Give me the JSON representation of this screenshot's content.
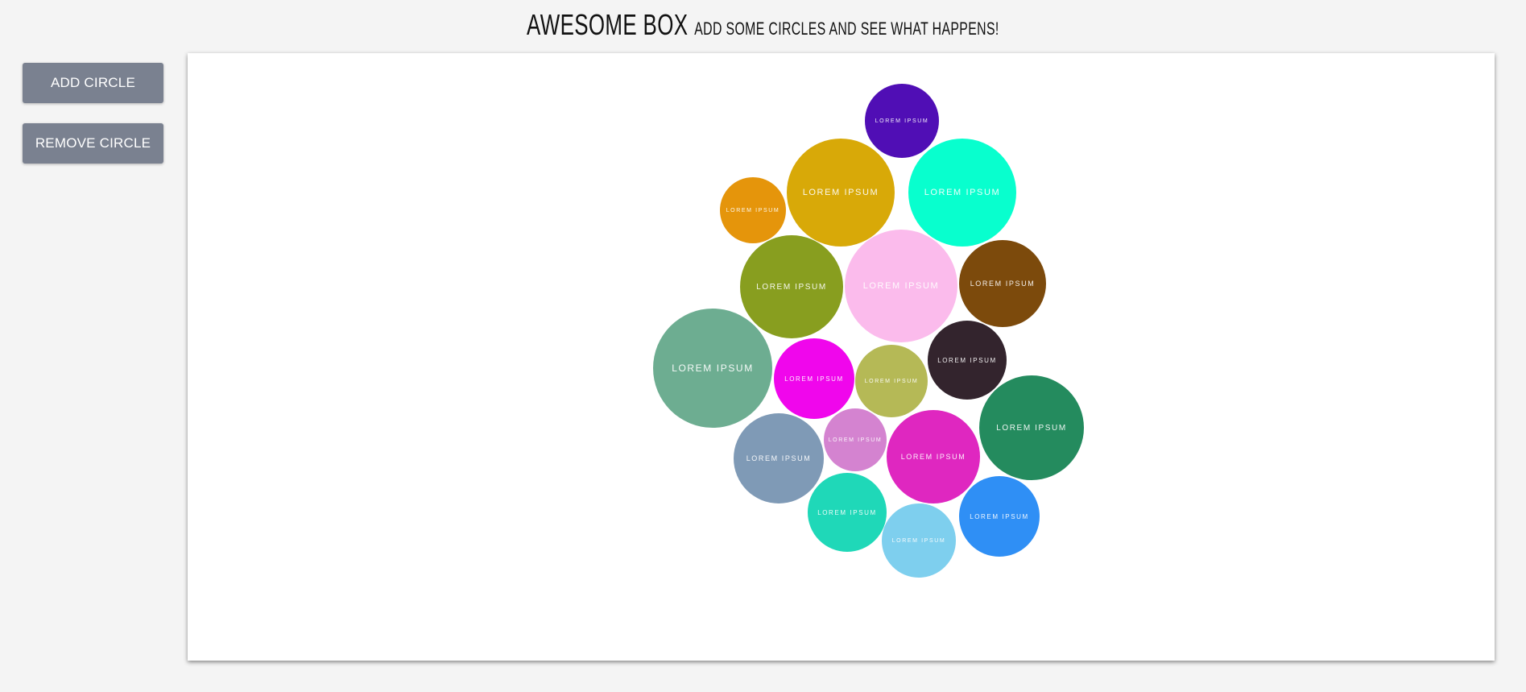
{
  "header": {
    "title": "AWESOME BOX",
    "subtitle": "ADD SOME CIRCLES AND SEE WHAT HAPPENS!"
  },
  "controls": {
    "add_label": "ADD CIRCLE",
    "remove_label": "REMOVE CIRCLE"
  },
  "colors": {
    "page_background": "#f4f4f4",
    "button_background": "#7a8190",
    "button_text": "#ffffff",
    "box_background": "#ffffff"
  },
  "circles": [
    {
      "label": "LOREM IPSUM",
      "color": "#500eb5"
    },
    {
      "label": "LOREM IPSUM",
      "color": "#d8a908"
    },
    {
      "label": "LOREM IPSUM",
      "color": "#08ffce"
    },
    {
      "label": "LOREM IPSUM",
      "color": "#e5950b"
    },
    {
      "label": "LOREM IPSUM",
      "color": "#889e1f"
    },
    {
      "label": "LOREM IPSUM",
      "color": "#fbbbec"
    },
    {
      "label": "LOREM IPSUM",
      "color": "#7c4a0c"
    },
    {
      "label": "LOREM IPSUM",
      "color": "#6dad91"
    },
    {
      "label": "LOREM IPSUM",
      "color": "#f006ec"
    },
    {
      "label": "LOREM IPSUM",
      "color": "#b5b956"
    },
    {
      "label": "LOREM IPSUM",
      "color": "#33242d"
    },
    {
      "label": "LOREM IPSUM",
      "color": "#248b5e"
    },
    {
      "label": "LOREM IPSUM",
      "color": "#7f9ab6"
    },
    {
      "label": "LOREM IPSUM",
      "color": "#d483d0"
    },
    {
      "label": "LOREM IPSUM",
      "color": "#df27c0"
    },
    {
      "label": "LOREM IPSUM",
      "color": "#1fd8b8"
    },
    {
      "label": "LOREM IPSUM",
      "color": "#7ecfee"
    },
    {
      "label": "LOREM IPSUM",
      "color": "#2f8ff5"
    }
  ]
}
